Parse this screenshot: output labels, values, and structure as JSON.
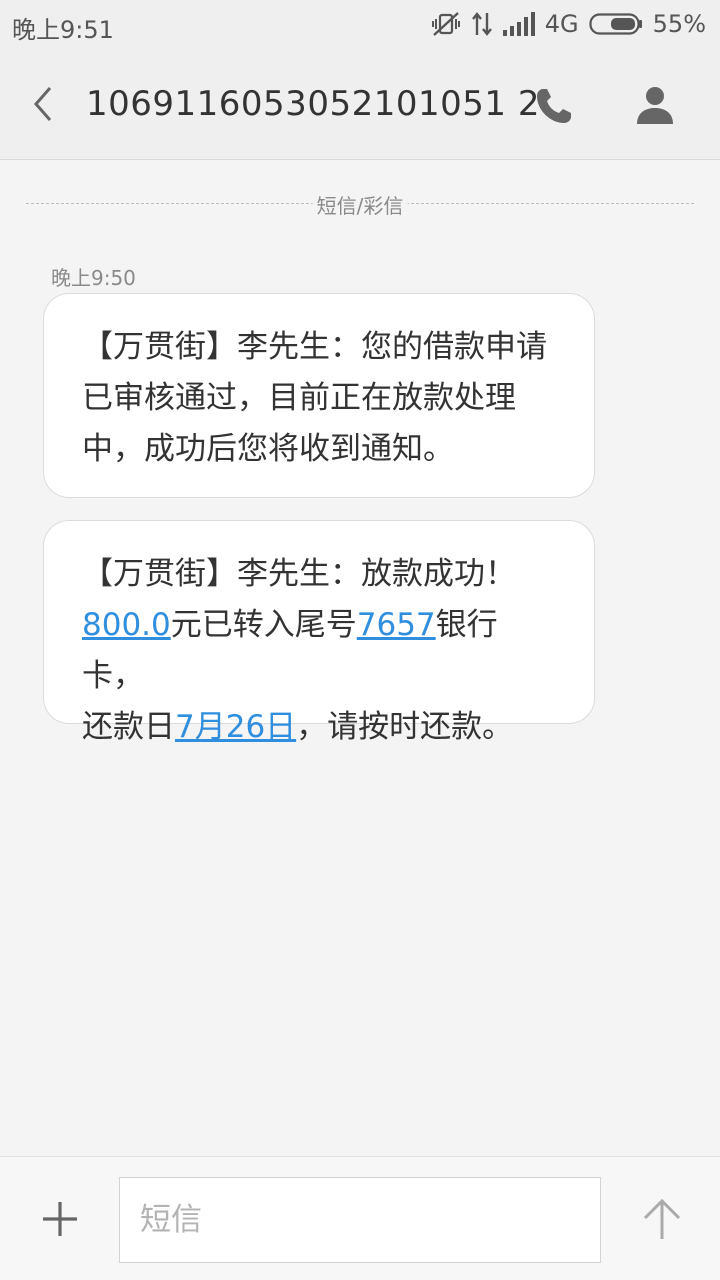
{
  "status_bar": {
    "time": "晚上9:51",
    "network": "4G",
    "battery": "55%",
    "icons": [
      "vibrate-off-icon",
      "data-transfer-icon",
      "signal-icon",
      "battery-icon"
    ]
  },
  "header": {
    "title": "1069116053052101051 2",
    "back_icon": "chevron-left-icon",
    "call_icon": "phone-icon",
    "contact_icon": "person-icon"
  },
  "conversation": {
    "channel_label": "短信/彩信",
    "message_time": "晚上9:50",
    "messages": [
      {
        "text": "【万贯街】李先生：您的借款申请已审核通过，目前正在放款处理中，成功后您将收到通知。"
      },
      {
        "prefix": "【万贯街】李先生：放款成功！",
        "amount": "800.0",
        "part2": "元已转入尾号",
        "card_tail": "7657",
        "part3": "银行卡，",
        "part4": "还款日",
        "due_date": "7月26日",
        "part5": "，请按时还款。"
      }
    ]
  },
  "composer": {
    "placeholder": "短信",
    "add_icon": "plus-icon",
    "send_icon": "arrow-up-icon"
  },
  "colors": {
    "link": "#2f8fde",
    "background": "#f4f4f4",
    "header": "#efefef"
  }
}
